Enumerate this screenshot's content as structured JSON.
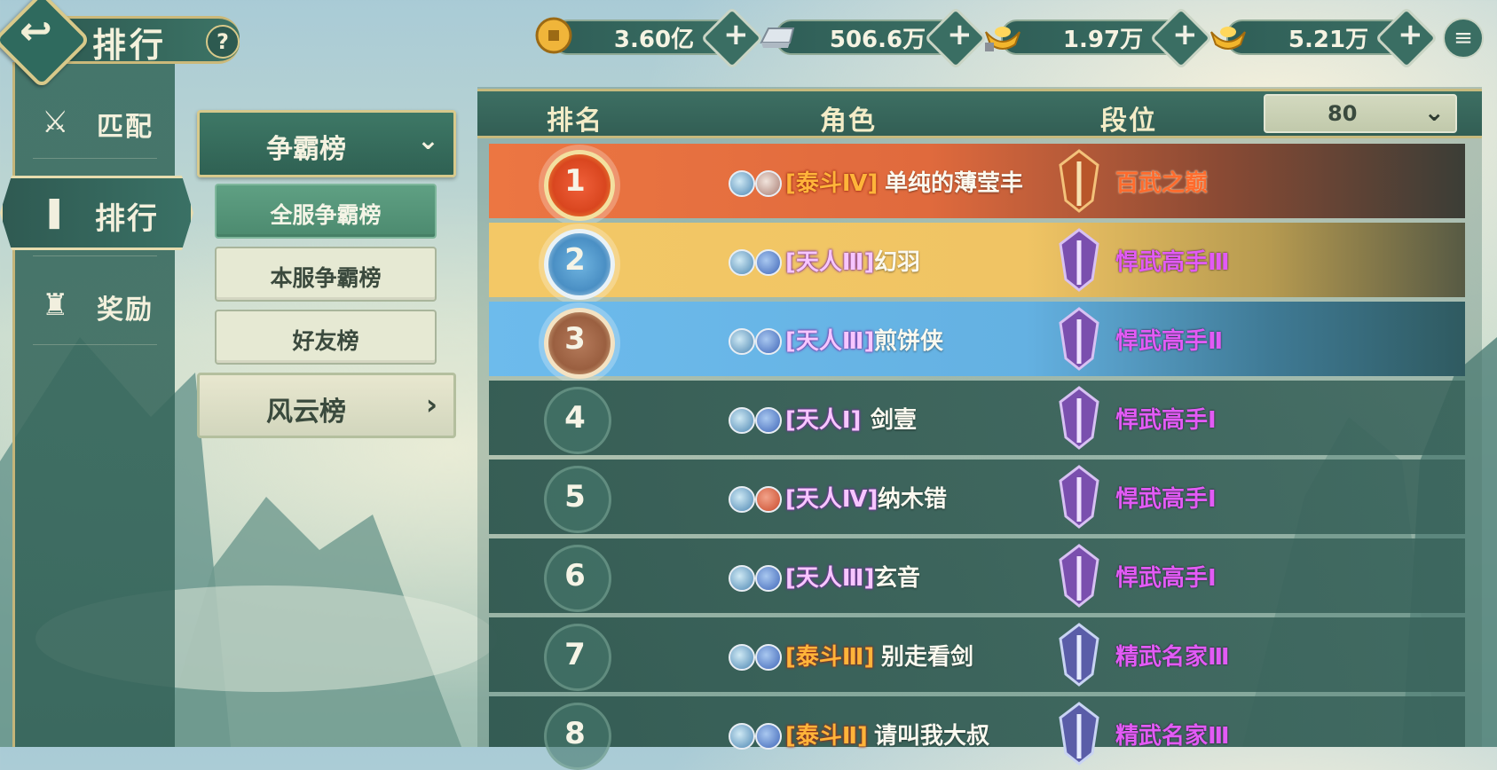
{
  "header": {
    "title": "排行",
    "help_label": "?"
  },
  "currencies": [
    {
      "icon": "copper-coin-icon",
      "value": "3.60亿"
    },
    {
      "icon": "silver-ingot-icon",
      "value": "506.6万"
    },
    {
      "icon": "locked-gold-ingot-icon",
      "value": "1.97万"
    },
    {
      "icon": "gold-ingot-icon",
      "value": "5.21万"
    }
  ],
  "add_label": "+",
  "menu_icon": "≡",
  "sidebar": {
    "items": [
      {
        "label": "匹配",
        "icon": "crossed-swords-icon",
        "glyph": "⚔"
      },
      {
        "label": "排行",
        "icon": "scroll-icon",
        "glyph": "❚"
      },
      {
        "label": "奖励",
        "icon": "reward-icon",
        "glyph": "♜"
      }
    ]
  },
  "submenu": {
    "header": "争霸榜",
    "chevron_down": "⌄",
    "options": [
      "全服争霸榜",
      "本服争霸榜",
      "好友榜"
    ],
    "feng": "风云榜",
    "chevron_right": "›"
  },
  "table": {
    "columns": [
      "排名",
      "角色",
      "段位"
    ],
    "level_filter": "80",
    "level_chevron": "⌄",
    "rows": [
      {
        "rank": "1",
        "tag": "[泰斗Ⅳ]",
        "name": "单纯的薄莹丰",
        "tier": "百武之巅"
      },
      {
        "rank": "2",
        "tag": "[天人Ⅲ]",
        "name": "幻羽",
        "tier": "悍武高手Ⅲ"
      },
      {
        "rank": "3",
        "tag": "[天人Ⅲ]",
        "name": "煎饼侠",
        "tier": "悍武高手Ⅱ"
      },
      {
        "rank": "4",
        "tag": "[天人Ⅰ]",
        "name": "剑壹",
        "tier": "悍武高手Ⅰ"
      },
      {
        "rank": "5",
        "tag": "[天人Ⅳ]",
        "name": "纳木错",
        "tier": "悍武高手Ⅰ"
      },
      {
        "rank": "6",
        "tag": "[天人Ⅲ]",
        "name": "玄音",
        "tier": "悍武高手Ⅰ"
      },
      {
        "rank": "7",
        "tag": "[泰斗Ⅲ]",
        "name": "别走看剑",
        "tier": "精武名家Ⅲ"
      },
      {
        "rank": "8",
        "tag": "[泰斗Ⅱ]",
        "name": "请叫我大叔",
        "tier": "精武名家Ⅲ"
      }
    ]
  },
  "colors": {
    "row1": "#e8743f",
    "row2": "#f0c766",
    "row3": "#6bb7e6",
    "row_dark": "#325e56",
    "accent_gold": "#d8c98a"
  }
}
